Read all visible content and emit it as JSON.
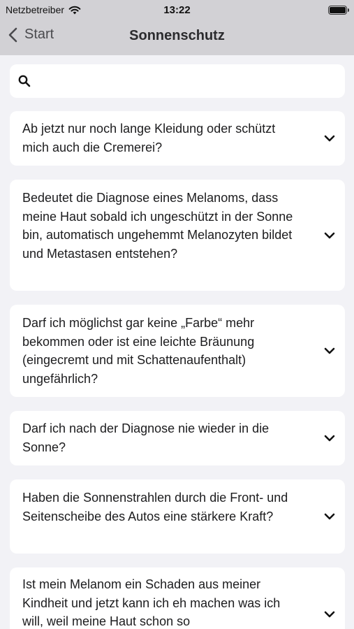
{
  "status": {
    "carrier": "Netzbetreiber",
    "time": "13:22"
  },
  "nav": {
    "back_label": "Start",
    "title": "Sonnenschutz"
  },
  "search": {
    "value": "",
    "placeholder": ""
  },
  "faq": [
    {
      "question": "Ab jetzt nur noch lange Kleidung oder schützt mich auch die Cremerei?"
    },
    {
      "question": "Bedeutet die Diagnose eines Melanoms, dass meine Haut sobald ich ungeschützt in der Sonne bin, automatisch ungehemmt Melanozyten bildet und Metastasen entstehen?"
    },
    {
      "question": "Darf ich möglichst gar keine „Farbe“ mehr bekommen oder ist eine leichte Bräunung (eingecremt und mit Schattenaufenthalt) ungefährlich?"
    },
    {
      "question": "Darf ich nach der Diagnose nie wieder in die Sonne?"
    },
    {
      "question": "Haben die Sonnenstrahlen durch die Front- und Seitenscheibe des Autos eine stärkere Kraft?"
    },
    {
      "question": "Ist mein Melanom ein Schaden aus meiner Kindheit und jetzt kann ich eh machen was ich will, weil meine Haut schon so"
    }
  ],
  "icons": {
    "wifi": "wifi-icon",
    "battery": "battery-icon",
    "back": "chevron-left-icon",
    "search": "search-icon",
    "expand": "chevron-down-icon"
  }
}
